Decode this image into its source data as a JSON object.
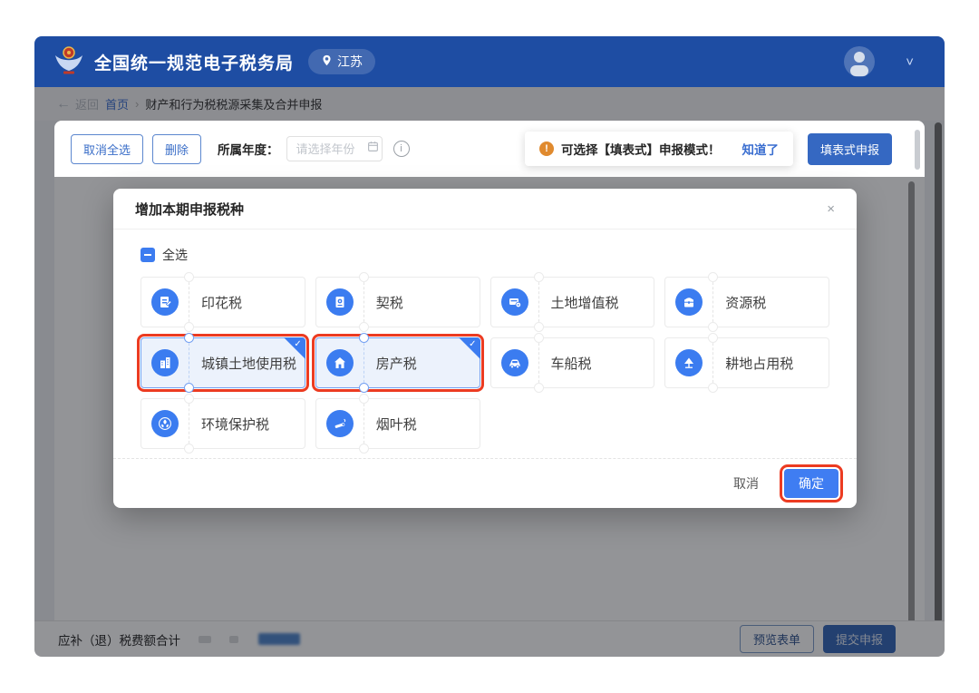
{
  "header": {
    "title": "全国统一规范电子税务局",
    "region": "江苏"
  },
  "breadcrumb": {
    "back": "返回",
    "home": "首页",
    "current": "财产和行为税税源采集及合并申报"
  },
  "toolbar": {
    "cancel_all_button": "取消全选",
    "delete_button": "删除",
    "year_label": "所属年度：",
    "year_placeholder": "请选择年份",
    "notice_text": "可选择【填表式】申报模式！",
    "notice_action": "知道了",
    "form_mode_button": "填表式申报"
  },
  "modal": {
    "title": "增加本期申报税种",
    "select_all": "全选",
    "cancel_button": "取消",
    "confirm_button": "确定",
    "taxes": [
      {
        "label": "印花税",
        "selected": false,
        "icon": "stamp-tax-icon"
      },
      {
        "label": "契税",
        "selected": false,
        "icon": "deed-tax-icon"
      },
      {
        "label": "土地增值税",
        "selected": false,
        "icon": "land-vat-icon"
      },
      {
        "label": "资源税",
        "selected": false,
        "icon": "resource-tax-icon"
      },
      {
        "label": "城镇土地使用税",
        "selected": true,
        "icon": "urban-land-tax-icon"
      },
      {
        "label": "房产税",
        "selected": true,
        "icon": "house-tax-icon"
      },
      {
        "label": "车船税",
        "selected": false,
        "icon": "vehicle-vessel-tax-icon"
      },
      {
        "label": "耕地占用税",
        "selected": false,
        "icon": "farmland-tax-icon"
      },
      {
        "label": "环境保护税",
        "selected": false,
        "icon": "environment-tax-icon"
      },
      {
        "label": "烟叶税",
        "selected": false,
        "icon": "tobacco-tax-icon"
      }
    ]
  },
  "footer": {
    "total_label": "应补（退）税费额合计",
    "preview_button": "预览表单",
    "submit_button": "提交申报"
  },
  "icons": {
    "back_arrow": "←",
    "separator": "›",
    "close": "×",
    "check": "✓",
    "exclamation": "!",
    "info": "i",
    "chevron_down": "˅"
  },
  "colors": {
    "header_blue": "#1e4da3",
    "primary_blue": "#3c7cf0",
    "annotation_red": "#ec3b21",
    "notice_orange": "#e08a2e",
    "selected_card_bg": "#ecf2fc"
  }
}
